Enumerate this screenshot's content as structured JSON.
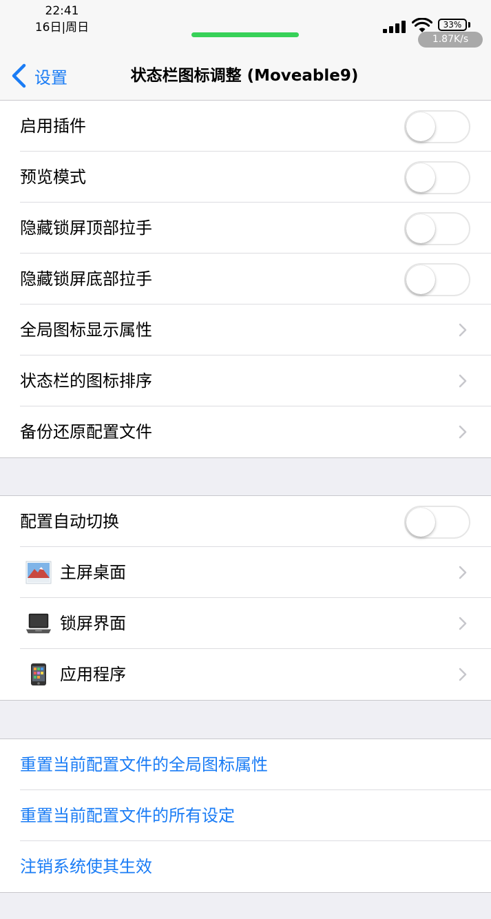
{
  "status_bar": {
    "time": "22:41",
    "date": "16日|周日",
    "battery": "33%",
    "net_speed": "1.87K/s"
  },
  "nav": {
    "back_label": "设置",
    "title": "状态栏图标调整 (Moveable9)"
  },
  "group1": [
    {
      "label": "启用插件",
      "control": "toggle",
      "on": false
    },
    {
      "label": "预览模式",
      "control": "toggle",
      "on": false
    },
    {
      "label": "隐藏锁屏顶部拉手",
      "control": "toggle",
      "on": false
    },
    {
      "label": "隐藏锁屏底部拉手",
      "control": "toggle",
      "on": false
    },
    {
      "label": "全局图标显示属性",
      "control": "chevron"
    },
    {
      "label": "状态栏的图标排序",
      "control": "chevron"
    },
    {
      "label": "备份还原配置文件",
      "control": "chevron"
    }
  ],
  "group2": [
    {
      "label": "配置自动切换",
      "control": "toggle",
      "on": false
    },
    {
      "label": "主屏桌面",
      "control": "chevron",
      "icon": "home-wallpaper-icon"
    },
    {
      "label": "锁屏界面",
      "control": "chevron",
      "icon": "laptop-icon"
    },
    {
      "label": "应用程序",
      "control": "chevron",
      "icon": "phone-icon"
    }
  ],
  "group3": [
    {
      "label": "重置当前配置文件的全局图标属性"
    },
    {
      "label": "重置当前配置文件的所有设定"
    },
    {
      "label": "注销系统使其生效"
    }
  ],
  "colors": {
    "accent": "#1a7cf5",
    "background": "#efeff4",
    "activity": "#37d158"
  }
}
